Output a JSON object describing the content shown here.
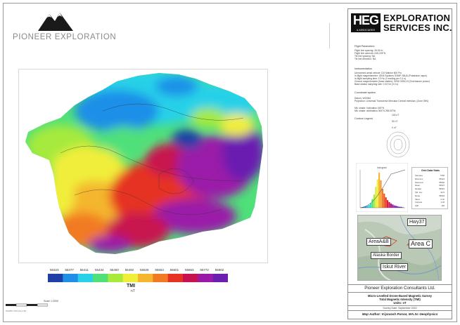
{
  "company": {
    "name": "PIONEER EXPLORATION",
    "logo_icon": "mountain-icon"
  },
  "colors": {
    "accent_dark": "#111111",
    "frame": "#8d8d8d"
  },
  "map": {
    "grid_ticks_top": [
      "",
      "",
      "",
      "",
      "",
      "",
      ""
    ],
    "scale_label": "Scale 1:2000",
    "scale_note": "NAD83 UTM Zone 9N"
  },
  "legend": {
    "values": [
      "55323",
      "55377",
      "55411",
      "55434",
      "55460",
      "55492",
      "55526",
      "55554",
      "55601",
      "55663",
      "55772",
      "55902"
    ],
    "colors": [
      "#1e3fa6",
      "#1f8fe8",
      "#27d1e8",
      "#4fe07a",
      "#a6ea3c",
      "#f1ee3a",
      "#f4b62f",
      "#f27a22",
      "#e63223",
      "#c8124f",
      "#9a1aa8",
      "#6a1fb0"
    ],
    "title": "TMI",
    "unit": "nT"
  },
  "title_block": {
    "brand_short": "HEG",
    "brand_sub": "& ASSOCIATES",
    "line1": "EXPLORATION",
    "line2": "SERVICES INC.",
    "flight_params_head": "Flight Parameters",
    "flight_params": [
      "Flight line spacing: 25-50 m",
      "Flight line azimuth: 045-225°N",
      "Tie line spacing: NA",
      "Tie line direction: NA"
    ],
    "instr_head": "Instrumentation",
    "instr": [
      "Unmanned aerial vehicle: DJI Matrice 600 Pro",
      "In-flight magnetometer: GEM Systems GSMP-35UA (Potassium vapor)",
      "In-flight sampling time: 10 Hz (1 reading per 0.1 s)",
      "Ground magnetometer (base station): GEM GSM-19 (Overhauser proton)",
      "Base station sampling rate: 0.33 Hz (3.0 s)"
    ],
    "coord_head": "Coordinate system",
    "coord": [
      "Datum: WGS84",
      "Projection: Universal Transverse Mercator Central meridian: (Zone 09N)"
    ],
    "field": [
      "Mit. shade: Inclination 045°N",
      "Mit. shade: declination 000°N 255.00°W"
    ],
    "contour_head": "Contour Legend",
    "contour": [
      "100 nT",
      "50 nT",
      "0 nT"
    ]
  },
  "stats": {
    "title": "Grid Data Stats",
    "rows": [
      {
        "k": "Samples",
        "v": "7048"
      },
      {
        "k": "Minimum",
        "v": "55323"
      },
      {
        "k": "Maximum",
        "v": "55902"
      },
      {
        "k": "Mean",
        "v": "55537"
      },
      {
        "k": "Median",
        "v": "55522"
      },
      {
        "k": "Std. dev.",
        "v": "92.5"
      },
      {
        "k": "Mode",
        "v": "55504"
      },
      {
        "k": "Skew",
        "v": "0.42"
      },
      {
        "k": "Kurtosis",
        "v": "3.18"
      },
      {
        "k": "IQR",
        "v": "118"
      }
    ]
  },
  "histogram": {
    "label": "histogram",
    "bars": [
      1,
      2,
      3,
      4,
      6,
      10,
      18,
      28,
      44,
      60,
      74,
      58,
      40,
      30,
      22,
      16,
      12,
      9,
      7,
      5,
      4,
      3,
      2,
      2,
      1
    ],
    "colors": [
      "#1e3fa6",
      "#1f6fe0",
      "#1f8fe8",
      "#27b8e8",
      "#27d1e8",
      "#3fe0b0",
      "#4fe07a",
      "#a6ea3c",
      "#d8ee3a",
      "#f1ee3a",
      "#f4b62f",
      "#f29a2a",
      "#f27a22",
      "#ec5522",
      "#e63223",
      "#d81d3c",
      "#c8124f",
      "#b41678",
      "#9a1aa8",
      "#8a1cac",
      "#7a1eae",
      "#6a1fb0",
      "#6a1fb0",
      "#6a1fb0",
      "#6a1fb0"
    ]
  },
  "inset": {
    "labels": [
      {
        "text": "Hwy37"
      },
      {
        "text": "AreaA&B"
      },
      {
        "text": "Area C"
      },
      {
        "text": "Alaska Border"
      },
      {
        "text": "Iskut River"
      }
    ]
  },
  "footer": {
    "company": "Pioneer Exploration Consultants Ltd.",
    "survey_line1": "Micro-Levelled Drone-Based Magnetic Survey",
    "survey_line2": "Total Magnetic Intensity (TMI)",
    "survey_line3": "Units: nT",
    "survey_date": "Survey Date: September 2022",
    "author": "Map Author: Kiyavash Parvar, MA.Sc Geophysics"
  }
}
